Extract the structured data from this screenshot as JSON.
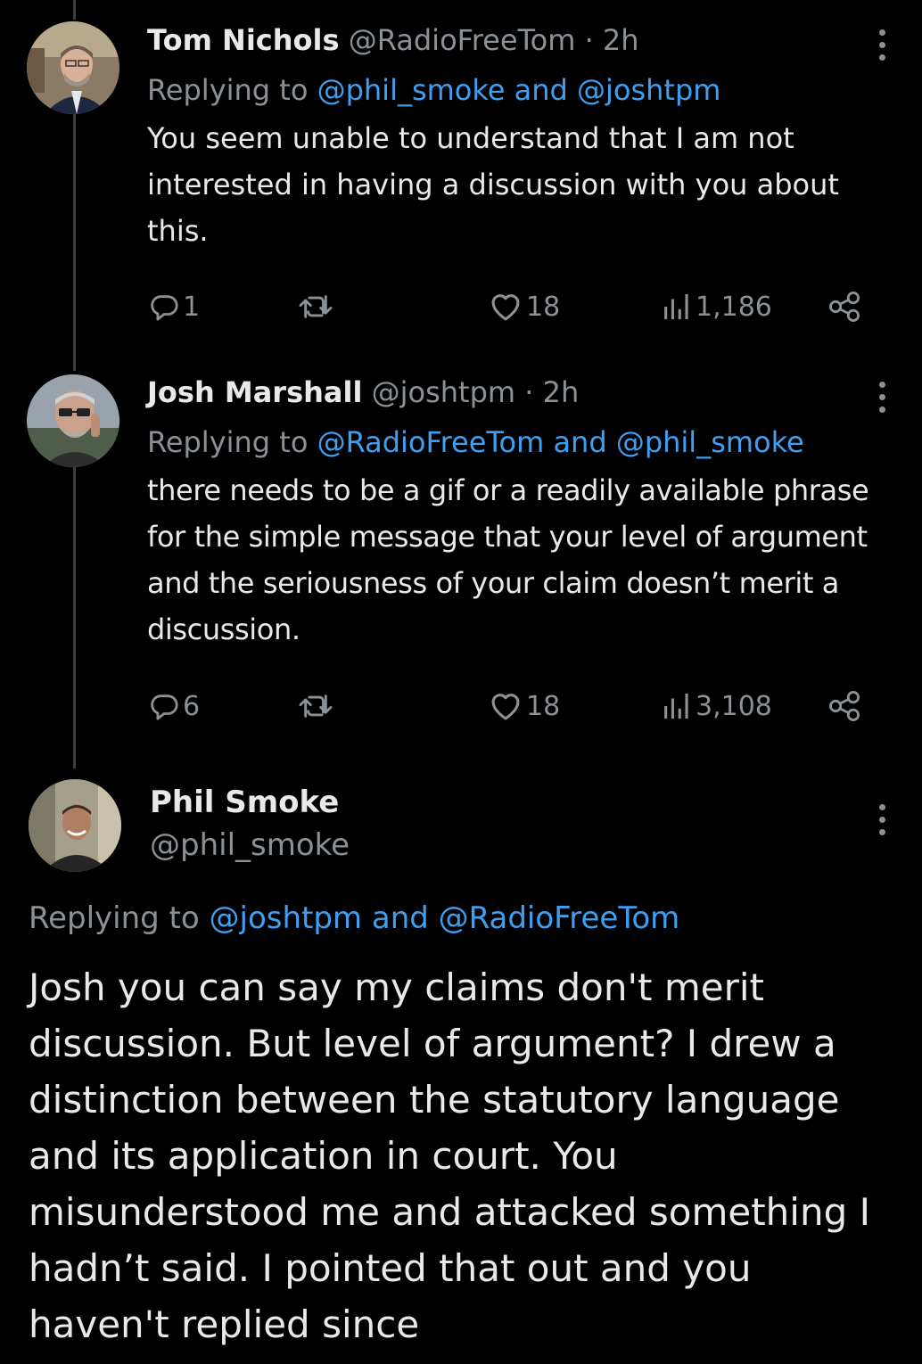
{
  "tweets": [
    {
      "name": "Tom Nichols",
      "handle": "@RadioFreeTom",
      "separator": "·",
      "time": "2h",
      "replying_prefix": "Replying to ",
      "mention1": "@phil_smoke",
      "and": " and ",
      "mention2": "@joshtpm",
      "text": "You seem unable to understand that I am not interested in having a discussion with you about this.",
      "replies": "1",
      "likes": "18",
      "views": "1,186"
    },
    {
      "name": "Josh Marshall",
      "handle": "@joshtpm",
      "separator": "·",
      "time": "2h",
      "replying_prefix": "Replying to ",
      "mention1": "@RadioFreeTom",
      "and": " and ",
      "mention2": "@phil_smoke",
      "text": "there needs to be a gif or a readily available phrase for the simple message that your level of argument and the seriousness of your claim doesn’t merit a discussion.",
      "replies": "6",
      "likes": "18",
      "views": "3,108"
    }
  ],
  "focus_tweet": {
    "name": "Phil Smoke",
    "handle": "@phil_smoke",
    "replying_prefix": "Replying to ",
    "mention1": "@joshtpm",
    "and": " and ",
    "mention2": "@RadioFreeTom",
    "text": "Josh you can say my claims don't merit discussion. But level of argument? I drew a distinction between the statutory language and its application in court. You misunderstood me and attacked something I hadn’t said. I pointed that out and you haven't replied since"
  },
  "icons": {
    "reply": "reply-icon",
    "retweet": "retweet-icon",
    "like": "heart-icon",
    "views": "views-icon",
    "share": "share-icon",
    "more": "more-options-icon"
  },
  "colors": {
    "background": "#000000",
    "text": "#e7e9ea",
    "secondary": "#8b9197",
    "link": "#3f9ff0",
    "thread_line": "#3a3d41"
  }
}
